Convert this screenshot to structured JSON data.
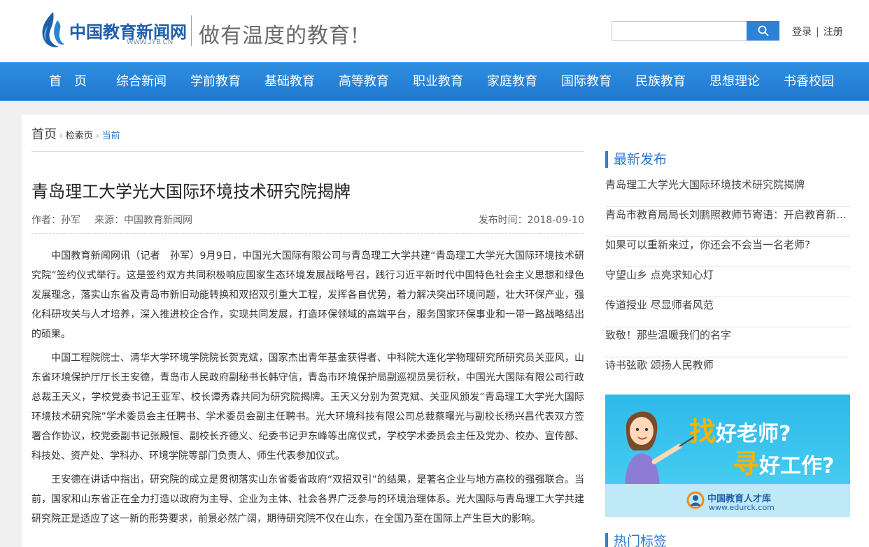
{
  "header": {
    "logo_text": "中国教育新闻网",
    "logo_url_text": "WWW.JYB.CN",
    "slogan": "做有温度的教育!",
    "search_placeholder": "",
    "search_icon": "search-icon",
    "login_label": "登录",
    "auth_separator": "|",
    "register_label": "注册"
  },
  "nav": {
    "items": [
      "首　页",
      "综合新闻",
      "学前教育",
      "基础教育",
      "高等教育",
      "职业教育",
      "家庭教育",
      "国际教育",
      "民族教育",
      "思想理论",
      "书香校园"
    ]
  },
  "breadcrumb": {
    "home": "首页",
    "level1": "检索页",
    "current": "当前"
  },
  "article": {
    "title": "青岛理工大学光大国际环境技术研究院揭牌",
    "author_label": "作者：",
    "author": "孙军",
    "source_label": "来源：",
    "source": "中国教育新闻网",
    "publish_label": "发布时间：",
    "publish_date": "2018-09-10",
    "paragraphs": [
      "中国教育新闻网讯（记者　孙军）9月9日，中国光大国际有限公司与青岛理工大学共建“青岛理工大学光大国际环境技术研究院”签约仪式举行。这是签约双方共同积极响应国家生态环境发展战略号召，践行习近平新时代中国特色社会主义思想和绿色发展理念，落实山东省及青岛市新旧动能转换和双招双引重大工程，发挥各自优势，着力解决突出环境问题，壮大环保产业，强化科研攻关与人才培养，深入推进校企合作，实现共同发展，打造环保领域的高端平台，服务国家环保事业和一带一路战略结出的硕果。",
      "中国工程院院士、清华大学环境学院院长贺克斌，国家杰出青年基金获得者、中科院大连化学物理研究所研究员关亚风，山东省环境保护厅厅长王安德，青岛市人民政府副秘书长韩守信，青岛市环境保护局副巡视员吴衍秋，中国光大国际有限公司行政总裁王天义，学校党委书记王亚军、校长谭秀森共同为研究院揭牌。王天义分别为贺克斌、关亚风颁发“青岛理工大学光大国际环境技术研究院”学术委员会主任聘书、学术委员会副主任聘书。光大环境科技有限公司总裁蔡曙光与副校长杨兴昌代表双方签署合作协议，校党委副书记张殿恒、副校长齐德义、纪委书记尹东峰等出席仪式，学校学术委员会主任及党办、校办、宣传部、科技处、资产处、学科办、环境学院等部门负责人、师生代表参加仪式。",
      "王安德在讲话中指出，研究院的成立是贯彻落实山东省委省政府“双招双引”的结果，是著名企业与地方高校的强强联合。当前，国家和山东省正在全力打造以政府为主导、企业为主体、社会各界广泛参与的环境治理体系。光大国际与青岛理工大学共建研究院正是适应了这一新的形势要求，前景必然广阔，期待研究院不仅在山东，在全国乃至在国际上产生巨大的影响。"
    ]
  },
  "sidebar": {
    "latest_title": "最新发布",
    "latest": [
      "青岛理工大学光大国际环境技术研究院揭牌",
      "青岛市教育局局长刘鹏照教师节寄语：开启教育新篇章",
      "如果可以重新来过，你还会不会当一名老师?",
      "守望山乡 点亮求知心灯",
      "传道授业 尽显师者风范",
      "致敬！那些温暖我们的名字",
      "诗书弦歌 颂扬人民教师"
    ],
    "ad": {
      "line1_big": "找",
      "line1_rest": "好老师?",
      "line2_big": "寻",
      "line2_rest": "好工作?",
      "brand": "中国教育人才库",
      "url": "www.edurck.com"
    },
    "hot_title": "热门标签"
  },
  "colors": {
    "nav_bg": "#2483d6",
    "accent": "#2c77c9",
    "ad_bg": "#3bc2ec",
    "ad_highlight": "#f5b400"
  }
}
